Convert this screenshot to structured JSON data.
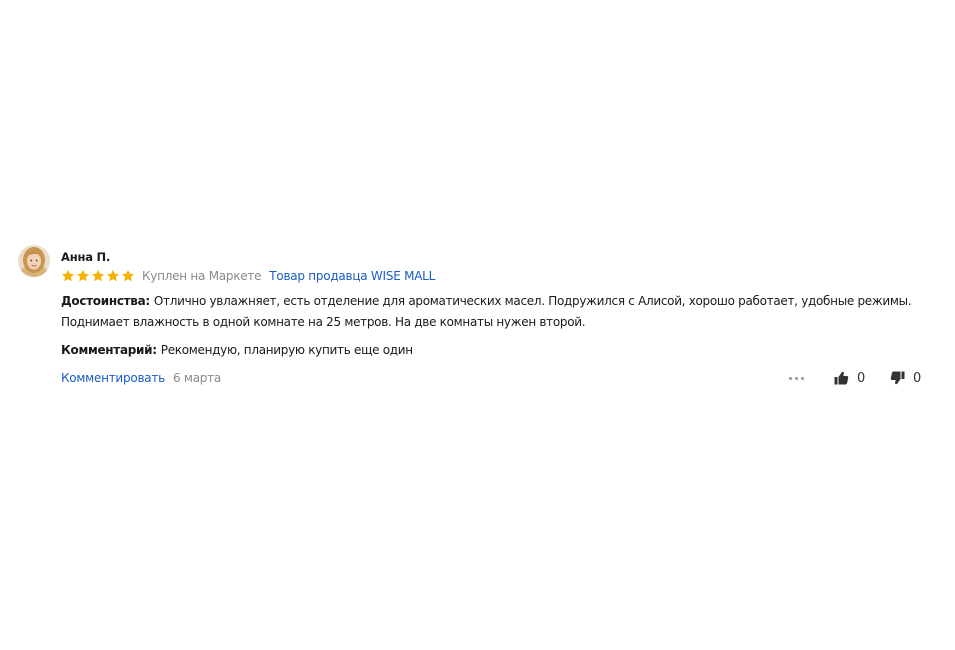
{
  "review": {
    "author": "Анна П.",
    "rating": 5,
    "rating_max": 5,
    "star_color": "#f5b200",
    "purchased_text": "Куплен на Маркете",
    "seller_link": "Товар продавца WISE MALL",
    "pros_label": "Достоинства:",
    "pros_text": "Отлично увлажняет, есть отделение для ароматических масел. Подружился с Алисой, хорошо работает, удобные режимы. Поднимает влажность в одной комнате на 25 метров. На две комнаты нужен второй.",
    "comment_label": "Комментарий:",
    "comment_text": "Рекомендую, планирую купить еще один",
    "reply_link": "Комментировать",
    "date": "6 марта",
    "likes": "0",
    "dislikes": "0"
  },
  "colors": {
    "link": "#1a5cc8",
    "muted": "#8a8a8a",
    "text": "#1a1a1a"
  },
  "icons": {
    "avatar": "user-avatar-photo",
    "like": "thumbs-up-icon",
    "dislike": "thumbs-down-icon",
    "more": "more-dots-icon",
    "star": "star-icon"
  }
}
